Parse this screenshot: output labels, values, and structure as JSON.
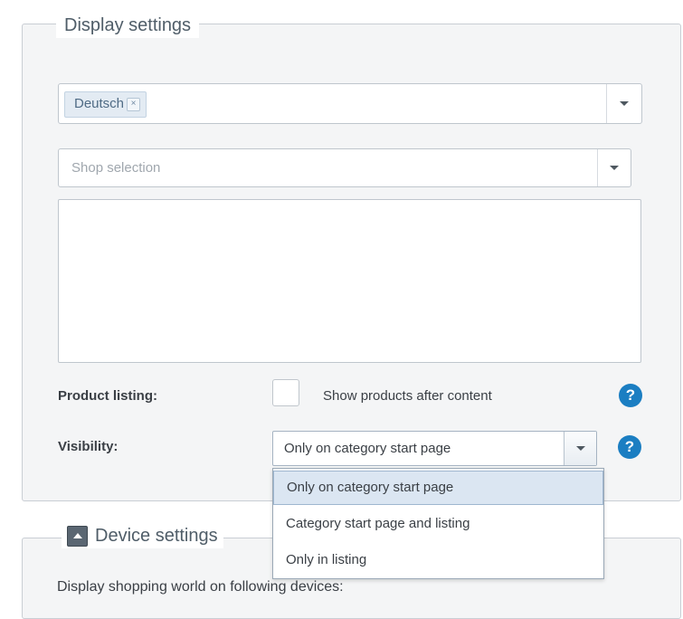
{
  "display_settings": {
    "legend": "Display settings",
    "language_combo": {
      "tags": [
        {
          "label": "Deutsch",
          "remove_icon": "×"
        }
      ]
    },
    "shop_combo": {
      "placeholder": "Shop selection"
    },
    "product_listing": {
      "label": "Product listing:",
      "checkbox_label": "Show products after content",
      "checked": false,
      "help": "?"
    },
    "visibility": {
      "label": "Visibility:",
      "value": "Only on category start page",
      "help": "?",
      "options": [
        "Only on category start page",
        "Category start page and listing",
        "Only in listing"
      ],
      "selected_index": 0
    }
  },
  "device_settings": {
    "legend": "Device settings",
    "description": "Display shopping world on following devices:"
  }
}
